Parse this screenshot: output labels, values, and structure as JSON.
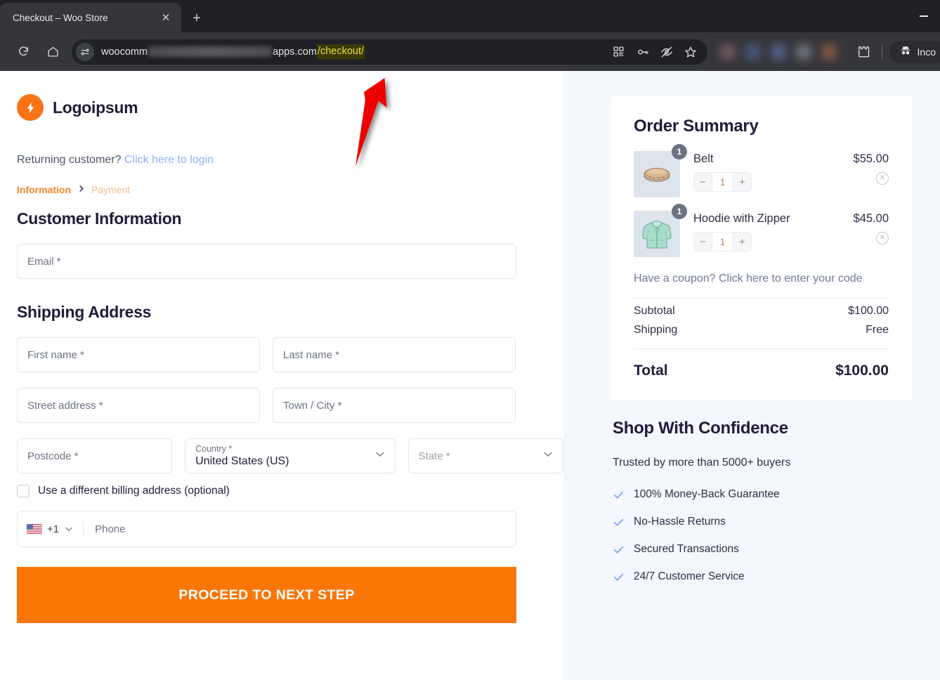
{
  "browser": {
    "tab_title": "Checkout – Woo Store",
    "close_label": "✕",
    "newtab_label": "+",
    "url_prefix": "woocomm",
    "url_suffix": "apps.com",
    "url_highlight": "/checkout/",
    "incognito_label": "Inco",
    "icons": {
      "reload": "reload-icon",
      "home": "home-icon",
      "site_info": "site-settings-icon",
      "qr": "qr-code-icon",
      "password": "password-key-icon",
      "tracking": "eye-off-icon",
      "bookmark": "star-icon",
      "extensions": "extensions-puzzle-icon",
      "incognito": "incognito-hat-icon",
      "minimize": "minimize-icon"
    }
  },
  "annotation": {
    "type": "red-arrow",
    "color": "#ee0000"
  },
  "store": {
    "logo_text": "Logoipsum",
    "returning_text": "Returning customer?",
    "returning_link": "Click here to login",
    "breadcrumb": {
      "current": "Information",
      "separator": "›",
      "next": "Payment"
    }
  },
  "form": {
    "customer_heading": "Customer Information",
    "email_placeholder": "Email *",
    "shipping_heading": "Shipping Address",
    "first_name_placeholder": "First name *",
    "last_name_placeholder": "Last name *",
    "street_placeholder": "Street address *",
    "city_placeholder": "Town / City *",
    "postcode_placeholder": "Postcode *",
    "country_label": "Country *",
    "country_value": "United States (US)",
    "state_placeholder": "State *",
    "billing_checkbox_label": "Use a different billing address (optional)",
    "phone_country_code": "+1",
    "phone_placeholder": "Phone",
    "submit_label": "PROCEED TO NEXT STEP"
  },
  "order_summary": {
    "title": "Order Summary",
    "items": [
      {
        "name": "Belt",
        "price": "$55.00",
        "qty": "1",
        "badge": "1",
        "minus": "−",
        "plus": "+",
        "remove": "✕",
        "thumb": "belt-thumbnail"
      },
      {
        "name": "Hoodie with Zipper",
        "price": "$45.00",
        "qty": "1",
        "badge": "1",
        "minus": "−",
        "plus": "+",
        "remove": "✕",
        "thumb": "hoodie-thumbnail"
      }
    ],
    "coupon_text": "Have a coupon? Click here to enter your code",
    "subtotal_label": "Subtotal",
    "subtotal_value": "$100.00",
    "shipping_label": "Shipping",
    "shipping_value": "Free",
    "total_label": "Total",
    "total_value": "$100.00"
  },
  "trust": {
    "title": "Shop With Confidence",
    "subtitle": "Trusted by more than 5000+ buyers",
    "items": [
      "100% Money-Back Guarantee",
      "No-Hassle Returns",
      "Secured Transactions",
      "24/7 Customer Service"
    ]
  },
  "colors": {
    "brand_orange": "#f97607",
    "panel_bg": "#f4f7fc",
    "dark_navy": "#221b3a",
    "link_blue": "#8ab4f8",
    "tick_blue": "#7fa9f0"
  }
}
